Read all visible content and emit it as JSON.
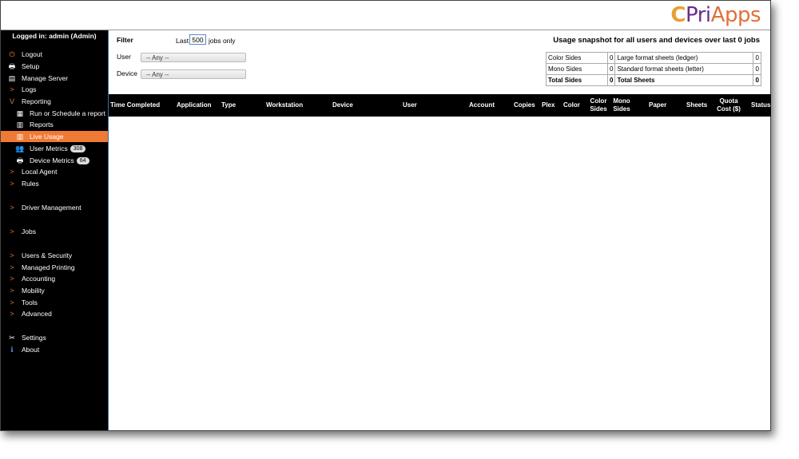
{
  "brand": {
    "logo_text": "PriApps"
  },
  "sidebar": {
    "logged_in": "Logged in: admin (Admin)",
    "items": [
      {
        "label": "Logout",
        "icon": "power-icon"
      },
      {
        "label": "Setup",
        "icon": "printer-icon"
      },
      {
        "label": "Manage Server",
        "icon": "server-edit-icon"
      },
      {
        "label": "Logs",
        "icon": "chevron-right-icon"
      },
      {
        "label": "Reporting",
        "icon": "chevron-down-icon"
      },
      {
        "label": "Run or Schedule a report",
        "icon": "report-schedule-icon"
      },
      {
        "label": "Reports",
        "icon": "clipboard-icon"
      },
      {
        "label": "Live Usage",
        "icon": "clipboard-icon"
      },
      {
        "label": "User Metrics",
        "icon": "users-icon",
        "badge": "308"
      },
      {
        "label": "Device Metrics",
        "icon": "printer-icon",
        "badge": "64"
      },
      {
        "label": "Local Agent",
        "icon": "chevron-right-icon"
      },
      {
        "label": "Rules",
        "icon": "chevron-right-icon"
      },
      {
        "label": "Driver Management",
        "icon": "chevron-right-icon"
      },
      {
        "label": "Jobs",
        "icon": "chevron-right-icon"
      },
      {
        "label": "Users & Security",
        "icon": "chevron-right-icon"
      },
      {
        "label": "Managed Printing",
        "icon": "chevron-right-icon"
      },
      {
        "label": "Accounting",
        "icon": "chevron-right-icon"
      },
      {
        "label": "Mobility",
        "icon": "chevron-right-icon"
      },
      {
        "label": "Tools",
        "icon": "chevron-right-icon"
      },
      {
        "label": "Advanced",
        "icon": "chevron-right-icon"
      },
      {
        "label": "Settings",
        "icon": "tools-icon"
      },
      {
        "label": "About",
        "icon": "info-icon"
      }
    ]
  },
  "filter": {
    "title": "Filter",
    "last_label": "Last",
    "last_value": "500",
    "jobs_only": "jobs only",
    "user_label": "User",
    "user_value": "-- Any --",
    "device_label": "Device",
    "device_value": "-- Any --"
  },
  "snapshot": {
    "title": "Usage snapshot for all users and devices over last 0 jobs",
    "rows": [
      [
        "Color Sides",
        "0",
        "Large format sheets (ledger)",
        "0"
      ],
      [
        "Mono Sides",
        "0",
        "Standard format sheets (letter)",
        "0"
      ],
      [
        "Total Sides",
        "0",
        "Total Sheets",
        "0"
      ]
    ]
  },
  "table": {
    "columns": [
      "Time Completed",
      "Application",
      "Type",
      "Workstation",
      "Device",
      "User",
      "Account",
      "Copies",
      "Plex",
      "Color",
      "Color Sides",
      "Mono Sides",
      "Paper",
      "Sheets",
      "Quota Cost ($)",
      "Status"
    ]
  }
}
